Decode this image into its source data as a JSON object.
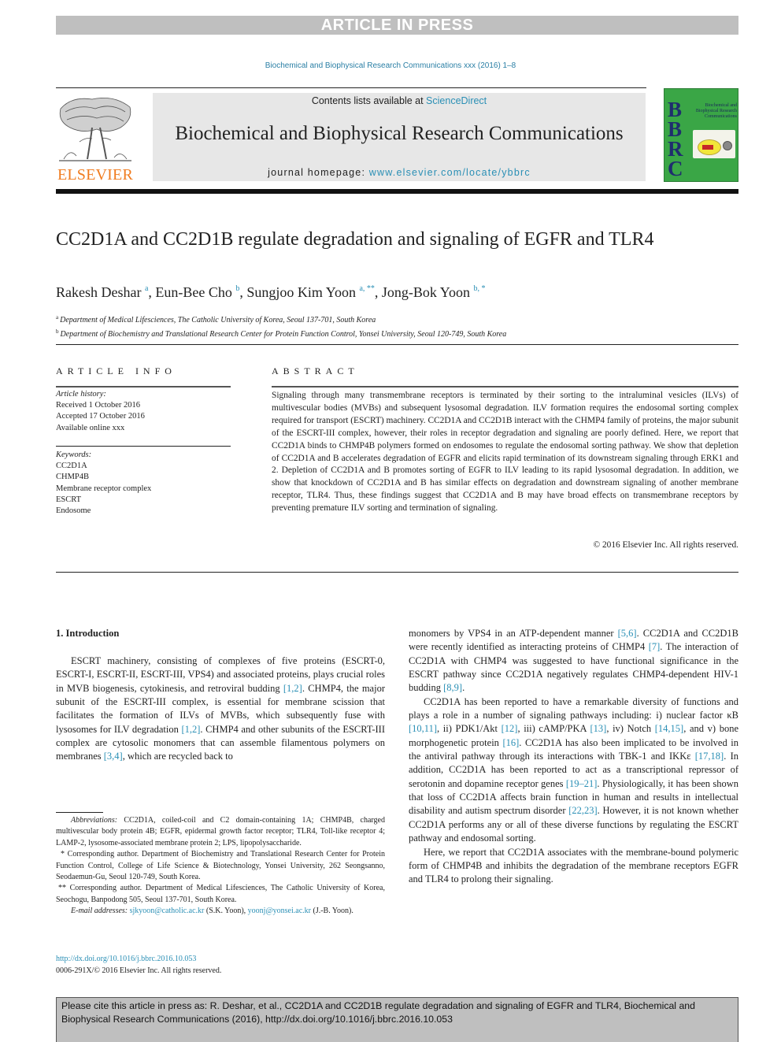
{
  "banner": "ARTICLE IN PRESS",
  "journal_ref": "Biochemical and Biophysical Research Communications xxx (2016) 1–8",
  "masthead": {
    "contents_prefix": "Contents lists available at ",
    "contents_link": "ScienceDirect",
    "journal_title": "Biochemical and Biophysical Research Communications",
    "homepage_prefix": "journal homepage: ",
    "homepage_link": "www.elsevier.com/locate/ybbrc",
    "publisher_logo_text": "ELSEVIER",
    "cover": {
      "letters": [
        "B",
        "B",
        "R",
        "C"
      ],
      "subtitle": "Biochemical and Biophysical Research Communications"
    }
  },
  "article": {
    "title": "CC2D1A and CC2D1B regulate degradation and signaling of EGFR and TLR4",
    "authors": [
      {
        "name": "Rakesh Deshar",
        "sup": "a",
        "sep": ", "
      },
      {
        "name": "Eun-Bee Cho",
        "sup": "b",
        "sep": ", "
      },
      {
        "name": "Sungjoo Kim Yoon",
        "sup": "a, **",
        "sep": ", "
      },
      {
        "name": "Jong-Bok Yoon",
        "sup": "b, *",
        "sep": ""
      }
    ],
    "affiliations": [
      {
        "mark": "a",
        "text": "Department of Medical Lifesciences, The Catholic University of Korea, Seoul 137-701, South Korea"
      },
      {
        "mark": "b",
        "text": "Department of Biochemistry and Translational Research Center for Protein Function Control, Yonsei University, Seoul 120-749, South Korea"
      }
    ]
  },
  "article_info": {
    "heading": "ARTICLE INFO",
    "history_label": "Article history:",
    "history": [
      "Received 1 October 2016",
      "Accepted 17 October 2016",
      "Available online xxx"
    ],
    "keywords_label": "Keywords:",
    "keywords": [
      "CC2D1A",
      "CHMP4B",
      "Membrane receptor complex",
      "ESCRT",
      "Endosome"
    ]
  },
  "abstract": {
    "heading": "ABSTRACT",
    "text": "Signaling through many transmembrane receptors is terminated by their sorting to the intraluminal vesicles (ILVs) of multivescular bodies (MVBs) and subsequent lysosomal degradation. ILV formation requires the endosomal sorting complex required for transport (ESCRT) machinery. CC2D1A and CC2D1B interact with the CHMP4 family of proteins, the major subunit of the ESCRT-III complex, however, their roles in receptor degradation and signaling are poorly defined. Here, we report that CC2D1A binds to CHMP4B polymers formed on endosomes to regulate the endosomal sorting pathway. We show that depletion of CC2D1A and B accelerates degradation of EGFR and elicits rapid termination of its downstream signaling through ERK1 and 2. Depletion of CC2D1A and B promotes sorting of EGFR to ILV leading to its rapid lysosomal degradation. In addition, we show that knockdown of CC2D1A and B has similar effects on degradation and downstream signaling of another membrane receptor, TLR4. Thus, these findings suggest that CC2D1A and B may have broad effects on transmembrane receptors by preventing premature ILV sorting and termination of signaling.",
    "copyright": "© 2016 Elsevier Inc. All rights reserved."
  },
  "introduction": {
    "heading": "1.  Introduction",
    "left_paragraph": [
      {
        "t": "ESCRT machinery, consisting of complexes of five proteins (ESCRT-0, ESCRT-I, ESCRT-II, ESCRT-III, VPS4) and associated proteins, plays crucial roles in MVB biogenesis, cytokinesis, and retroviral budding "
      },
      {
        "r": "[1,2]"
      },
      {
        "t": ". CHMP4, the major subunit of the ESCRT-III complex, is essential for membrane scission that facilitates the formation of ILVs of MVBs, which subsequently fuse with lysosomes for ILV degradation "
      },
      {
        "r": "[1,2]"
      },
      {
        "t": ". CHMP4 and other subunits of the ESCRT-III complex are cytosolic monomers that can assemble filamentous polymers on membranes "
      },
      {
        "r": "[3,4]"
      },
      {
        "t": ", which are recycled back to"
      }
    ],
    "right_paragraphs": [
      [
        {
          "t": "monomers by VPS4 in an ATP-dependent manner "
        },
        {
          "r": "[5,6]"
        },
        {
          "t": ". CC2D1A and CC2D1B were recently identified as interacting proteins of CHMP4 "
        },
        {
          "r": "[7]"
        },
        {
          "t": ". The interaction of CC2D1A with CHMP4 was suggested to have functional significance in the ESCRT pathway since CC2D1A negatively regulates CHMP4-dependent HIV-1 budding "
        },
        {
          "r": "[8,9]"
        },
        {
          "t": "."
        }
      ],
      [
        {
          "t": "CC2D1A has been reported to have a remarkable diversity of functions and plays a role in a number of signaling pathways including: i) nuclear factor κB "
        },
        {
          "r": "[10,11]"
        },
        {
          "t": ", ii) PDK1/Akt "
        },
        {
          "r": "[12]"
        },
        {
          "t": ", iii) cAMP/PKA "
        },
        {
          "r": "[13]"
        },
        {
          "t": ", iv) Notch "
        },
        {
          "r": "[14,15]"
        },
        {
          "t": ", and v) bone morphogenetic protein "
        },
        {
          "r": "[16]"
        },
        {
          "t": ". CC2D1A has also been implicated to be involved in the antiviral pathway through its interactions with TBK-1 and IKKε "
        },
        {
          "r": "[17,18]"
        },
        {
          "t": ". In addition, CC2D1A has been reported to act as a transcriptional repressor of serotonin and dopamine receptor genes "
        },
        {
          "r": "[19–21]"
        },
        {
          "t": ". Physiologically, it has been shown that loss of CC2D1A affects brain function in human and results in intellectual disability and autism spectrum disorder "
        },
        {
          "r": "[22,23]"
        },
        {
          "t": ". However, it is not known whether CC2D1A performs any or all of these diverse functions by regulating the ESCRT pathway and endosomal sorting."
        }
      ],
      [
        {
          "t": "Here, we report that CC2D1A associates with the membrane-bound polymeric form of CHMP4B and inhibits the degradation of the membrane receptors EGFR and TLR4 to prolong their signaling."
        }
      ]
    ]
  },
  "footnotes": {
    "abbreviations_label": "Abbreviations:",
    "abbreviations": " CC2D1A, coiled-coil and C2 domain-containing 1A; CHMP4B, charged multivescular body protein 4B; EGFR, epidermal growth factor receptor; TLR4, Toll-like receptor 4; LAMP-2, lysosome-associated membrane protein 2; LPS, lipopolysaccharide.",
    "corr1": "* Corresponding author. Department of Biochemistry and Translational Research Center for Protein Function Control, College of Life Science & Biotechnology, Yonsei University, 262 Seongsanno, Seodaemun-Gu, Seoul 120-749, South Korea.",
    "corr2": "** Corresponding author. Department of Medical Lifesciences, The Catholic University of Korea, Seochogu, Banpodong 505, Seoul 137-701, South Korea.",
    "email_label": "E-mail addresses:",
    "email1": "sjkyoon@catholic.ac.kr",
    "email1_owner": " (S.K. Yoon), ",
    "email2": "yoonj@yonsei.ac.kr",
    "email2_owner": " (J.-B. Yoon)."
  },
  "doi": {
    "link": "http://dx.doi.org/10.1016/j.bbrc.2016.10.053",
    "issn_line": "0006-291X/© 2016 Elsevier Inc. All rights reserved."
  },
  "cite_box": "Please cite this article in press as: R. Deshar, et al., CC2D1A and CC2D1B regulate degradation and signaling of EGFR and TLR4, Biochemical and Biophysical Research Communications (2016), http://dx.doi.org/10.1016/j.bbrc.2016.10.053"
}
